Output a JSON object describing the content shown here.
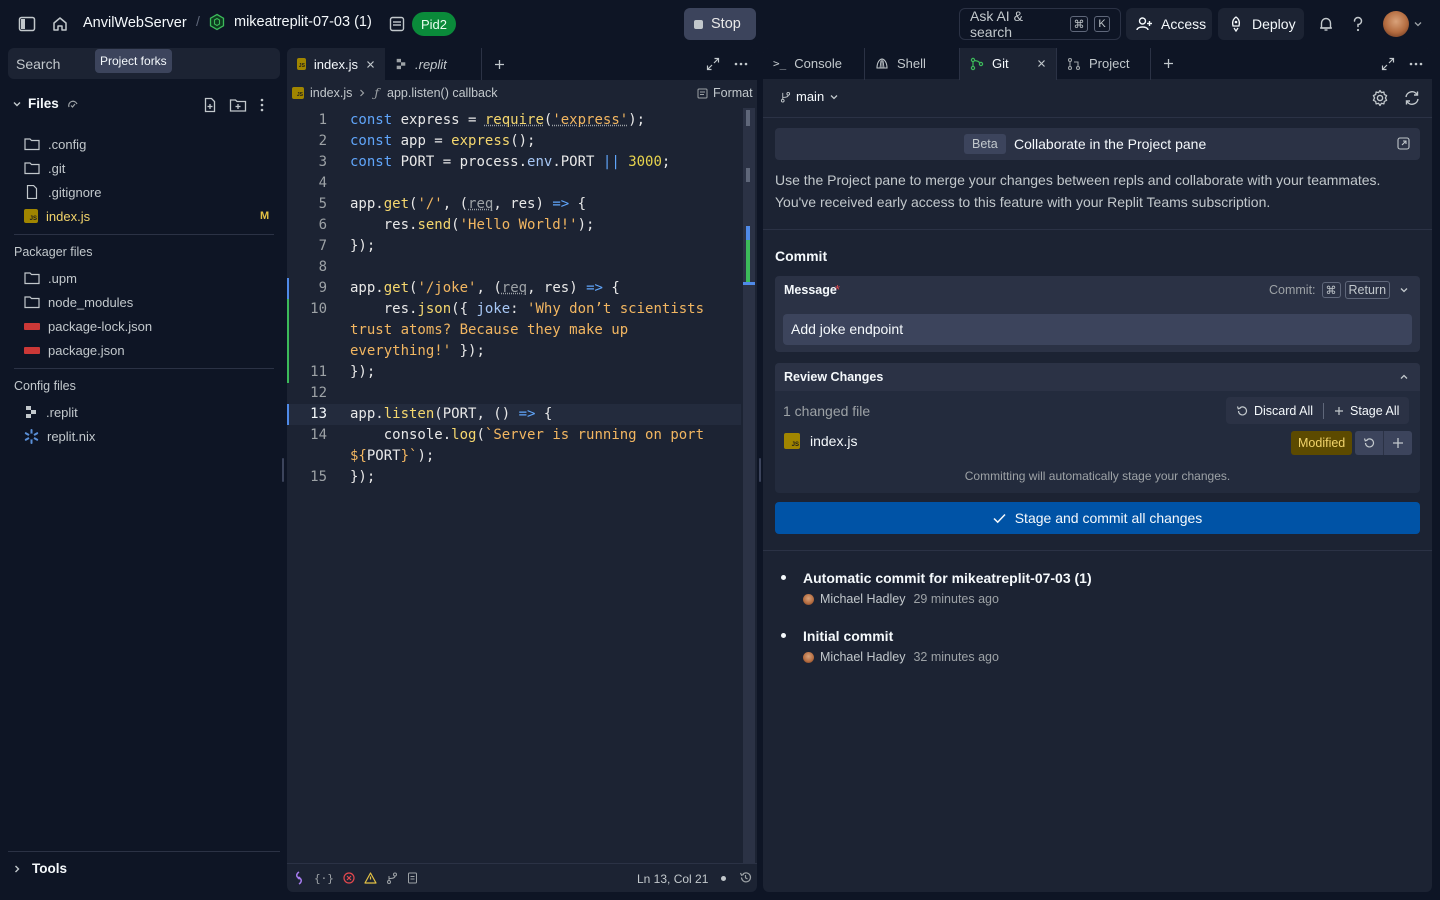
{
  "topbar": {
    "workspace": "AnvilWebServer",
    "repl_name": "mikeatreplit-07-03 (1)",
    "pid_badge": "Pid2",
    "stop_label": "Stop",
    "search_label": "Ask AI & search",
    "search_kbd1": "⌘",
    "search_kbd2": "K",
    "access_label": "Access",
    "deploy_label": "Deploy"
  },
  "sidebar": {
    "search_label": "Search",
    "tooltip": "Project forks",
    "files_title": "Files",
    "files": [
      {
        "name": ".config",
        "icon": "folder-icon"
      },
      {
        "name": ".git",
        "icon": "folder-icon"
      },
      {
        "name": ".gitignore",
        "icon": "file-icon"
      },
      {
        "name": "index.js",
        "icon": "js-icon",
        "badge": "M"
      }
    ],
    "packager_title": "Packager files",
    "packager_files": [
      {
        "name": ".upm",
        "icon": "folder-icon"
      },
      {
        "name": "node_modules",
        "icon": "folder-icon"
      },
      {
        "name": "package-lock.json",
        "icon": "npm-icon"
      },
      {
        "name": "package.json",
        "icon": "npm-icon"
      }
    ],
    "config_title": "Config files",
    "config_files": [
      {
        "name": ".replit",
        "icon": "replit-icon"
      },
      {
        "name": "replit.nix",
        "icon": "nix-icon"
      }
    ],
    "tools_label": "Tools"
  },
  "editor": {
    "tabs": [
      {
        "label": "index.js",
        "active": true
      },
      {
        "label": ".replit",
        "active": false
      }
    ],
    "breadcrumb_file": "index.js",
    "breadcrumb_symbol": "app.listen() callback",
    "format_label": "Format",
    "line_numbers": [
      "1",
      "2",
      "3",
      "4",
      "5",
      "6",
      "7",
      "8",
      "9",
      "10",
      "",
      "",
      "11",
      "12",
      "13",
      "14",
      "",
      "15"
    ],
    "status_position": "Ln 13, Col 21"
  },
  "right_tabs": [
    {
      "label": "Console",
      "icon": "console-icon"
    },
    {
      "label": "Shell",
      "icon": "shell-icon"
    },
    {
      "label": "Git",
      "icon": "git-icon",
      "active": true
    },
    {
      "label": "Project",
      "icon": "project-icon"
    }
  ],
  "git": {
    "branch": "main",
    "beta_badge": "Beta",
    "banner_title": "Collaborate in the Project pane",
    "banner_text_1": "Use the Project pane to merge your changes between repls and collaborate with your teammates.",
    "banner_text_2": "You've received early access to this feature with your Replit Teams subscription.",
    "commit_title": "Commit",
    "message_label": "Message",
    "required_mark": "*",
    "commit_shortcut_label": "Commit:",
    "commit_kbd1": "⌘",
    "commit_kbd2": "Return",
    "message_value": "Add joke endpoint",
    "review_title": "Review Changes",
    "changed_count": "1 changed file",
    "discard_all": "Discard All",
    "stage_all": "Stage All",
    "changed_file": "index.js",
    "modified_badge": "Modified",
    "auto_stage_note": "Committing will automatically stage your changes.",
    "commit_button": "Stage and commit all changes",
    "history": [
      {
        "title": "Automatic commit for mikeatreplit-07-03 (1)",
        "author": "Michael Hadley",
        "time": "29 minutes ago"
      },
      {
        "title": "Initial commit",
        "author": "Michael Hadley",
        "time": "32 minutes ago"
      }
    ]
  },
  "colors": {
    "background": "#0e1525",
    "panel": "#1c2333",
    "accent_blue": "#0053a6",
    "green_badge": "#0a8a3a",
    "modified_badge": "#5c4a00"
  }
}
